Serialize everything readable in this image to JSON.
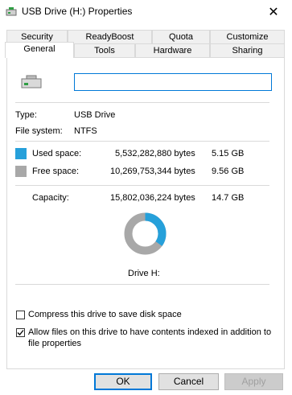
{
  "window": {
    "title": "USB Drive (H:) Properties",
    "close_glyph": "✕"
  },
  "tabs_row1": [
    "Security",
    "ReadyBoost",
    "Quota",
    "Customize"
  ],
  "tabs_row2": [
    "General",
    "Tools",
    "Hardware",
    "Sharing"
  ],
  "active_tab": "General",
  "general": {
    "drive_name_value": "",
    "type_label": "Type:",
    "type_value": "USB Drive",
    "fs_label": "File system:",
    "fs_value": "NTFS",
    "used_label": "Used space:",
    "used_bytes": "5,532,282,880 bytes",
    "used_gb": "5.15 GB",
    "free_label": "Free space:",
    "free_bytes": "10,269,753,344 bytes",
    "free_gb": "9.56 GB",
    "capacity_label": "Capacity:",
    "capacity_bytes": "15,802,036,224 bytes",
    "capacity_gb": "14.7 GB",
    "drive_caption": "Drive H:",
    "used_fraction": 0.35,
    "compress_label": "Compress this drive to save disk space",
    "compress_checked": false,
    "index_label_line1": "Allow files on this drive to have contents indexed in addition to",
    "index_label_line2": "file properties",
    "index_checked": true
  },
  "colors": {
    "used": "#26a0da",
    "free": "#a8a8a8"
  },
  "buttons": {
    "ok": "OK",
    "cancel": "Cancel",
    "apply": "Apply"
  },
  "icons": {
    "title": "usb-drive-icon",
    "drive": "usb-drive-icon",
    "close": "close-icon",
    "check": "checkmark-icon"
  }
}
